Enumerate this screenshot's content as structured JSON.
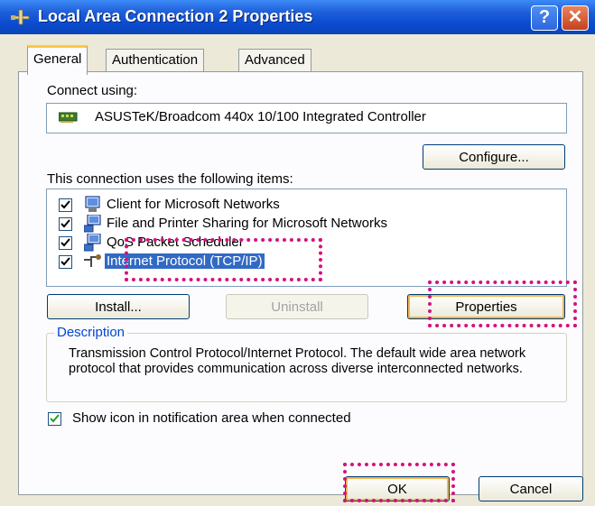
{
  "window": {
    "title": "Local Area Connection 2 Properties",
    "help_glyph": "?",
    "close_glyph": "✕"
  },
  "tabs": [
    {
      "label": "General",
      "active": true
    },
    {
      "label": "Authentication",
      "active": false
    },
    {
      "label": "Advanced",
      "active": false
    }
  ],
  "connect": {
    "label": "Connect using:",
    "adapter": "ASUSTeK/Broadcom 440x 10/100 Integrated Controller",
    "configure_button": "Configure..."
  },
  "items_section": {
    "label": "This connection uses the following items:",
    "items": [
      {
        "label": "Client for Microsoft Networks",
        "checked": true,
        "icon": "network-client-icon"
      },
      {
        "label": "File and Printer Sharing for Microsoft Networks",
        "checked": true,
        "icon": "network-service-icon"
      },
      {
        "label": "QoS Packet Scheduler",
        "checked": true,
        "icon": "network-service-icon"
      },
      {
        "label": "Internet Protocol (TCP/IP)",
        "checked": true,
        "icon": "protocol-icon",
        "selected": true
      }
    ]
  },
  "buttons": {
    "install": "Install...",
    "uninstall": "Uninstall",
    "properties": "Properties",
    "ok": "OK",
    "cancel": "Cancel"
  },
  "description": {
    "legend": "Description",
    "text": "Transmission Control Protocol/Internet Protocol. The default wide area network protocol that provides communication across diverse interconnected networks."
  },
  "notify": {
    "label": "Show icon in notification area when connected",
    "checked": true
  },
  "colors": {
    "titlebar": "#0a4bd0",
    "selection": "#316ac5",
    "highlight_annotation": "#d4127f",
    "dialog_face": "#ece9d8"
  }
}
